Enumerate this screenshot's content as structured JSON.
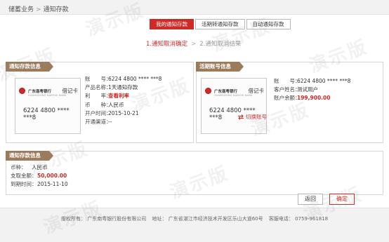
{
  "breadcrumb": {
    "parent": "储蓄业务",
    "separator": ">",
    "current": "通知存款"
  },
  "tabs": [
    {
      "label": "我的通知存款",
      "active": true
    },
    {
      "label": "活期转通知存款",
      "active": false
    },
    {
      "label": "自动通知存款",
      "active": false
    }
  ],
  "steps": {
    "step1": "1.通知取消确定",
    "separator": ">",
    "step2": "2.通知取消结果"
  },
  "deposit_panel": {
    "title": "通知存款信息",
    "card": {
      "bank": "广东南粤银行",
      "bank_en": "GUANGDONG NANYUE BANK",
      "type": "借记卡",
      "number": "6224 4800 **** ***8"
    },
    "fields": [
      {
        "label": "账　　号：",
        "value": "6224 4800 **** ***8",
        "style": ""
      },
      {
        "label": "产品名称：",
        "value": "1天通知存款",
        "style": ""
      },
      {
        "label": "利　　率：",
        "value": "查看利率",
        "style": "link"
      },
      {
        "label": "币　　种：",
        "value": "人民币",
        "style": ""
      },
      {
        "label": "开户时间：",
        "value": "2015-10-21",
        "style": ""
      },
      {
        "label": "开通渠道：",
        "value": "--",
        "style": ""
      }
    ]
  },
  "current_panel": {
    "title": "活期账号信息",
    "card": {
      "bank": "广东南粤银行",
      "bank_en": "GUANGDONG NANYUE BANK",
      "type": "借记卡",
      "number": "6224 4800 **** ***8"
    },
    "switch_label": "切换账号",
    "fields": [
      {
        "label": "账　　号：",
        "value": "6224 4800 **** ***8",
        "style": ""
      },
      {
        "label": "客户姓名：",
        "value": "测试用户",
        "style": ""
      },
      {
        "label": "账户余额：",
        "value": "199,900.00",
        "style": "red"
      }
    ]
  },
  "withdraw_panel": {
    "title": "通知存款信息",
    "fields": [
      {
        "label": "币种：",
        "value": "人民币",
        "style": ""
      },
      {
        "label": "支取金额：",
        "value": "50,000.00",
        "style": "red"
      },
      {
        "label": "到期时间：",
        "value": "2015-11-10",
        "style": ""
      }
    ]
  },
  "buttons": {
    "back": "返回",
    "confirm": "确定"
  },
  "footer": {
    "copyright": "版权所有： 广东南粤银行股份有限公司",
    "address": "地址： 广东省湛江市经济技术开发区乐山大道60号",
    "hotline": "客服电话： 0759-961818"
  },
  "watermark": "演示版",
  "colors": {
    "accent": "#cf2a27",
    "panel_title": "#9c7b5c",
    "footer_bg": "#f2f2f2"
  }
}
